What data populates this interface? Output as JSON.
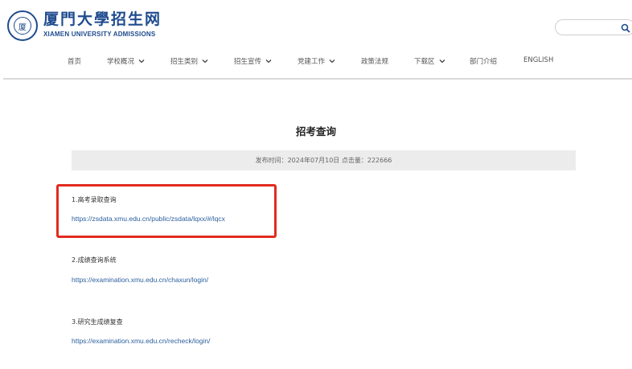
{
  "header": {
    "logo_cn": "厦門大學招生网",
    "logo_en": "XIAMEN UNIVERSITY ADMISSIONS",
    "search_placeholder": "",
    "search_icon": "search-icon"
  },
  "nav": {
    "items": [
      {
        "label": "首页",
        "has_dropdown": false
      },
      {
        "label": "学校概况",
        "has_dropdown": true
      },
      {
        "label": "招生类别",
        "has_dropdown": true
      },
      {
        "label": "招生宣传",
        "has_dropdown": true
      },
      {
        "label": "党建工作",
        "has_dropdown": true
      },
      {
        "label": "政策法规",
        "has_dropdown": false
      },
      {
        "label": "下载区",
        "has_dropdown": true
      },
      {
        "label": "部门介绍",
        "has_dropdown": false
      },
      {
        "label": "ENGLISH",
        "has_dropdown": false
      }
    ]
  },
  "article": {
    "title": "招考查询",
    "meta": "发布时间：2024年07月10日 点击量：222666",
    "items": [
      {
        "title": "1.高考录取查询",
        "link": "https://zsdata.xmu.edu.cn/public/zsdata/lqxx/#/lqcx"
      },
      {
        "title": "2.成绩查询系统",
        "link": "https://examination.xmu.edu.cn/chaxun/login/"
      },
      {
        "title": "3.研究生成绩复查",
        "link": "https://examination.xmu.edu.cn/recheck/login/"
      }
    ]
  },
  "colors": {
    "brand": "#1f4b8e",
    "link": "#2b5f9e",
    "highlight": "#e22b20",
    "meta_bg": "#ececec"
  }
}
